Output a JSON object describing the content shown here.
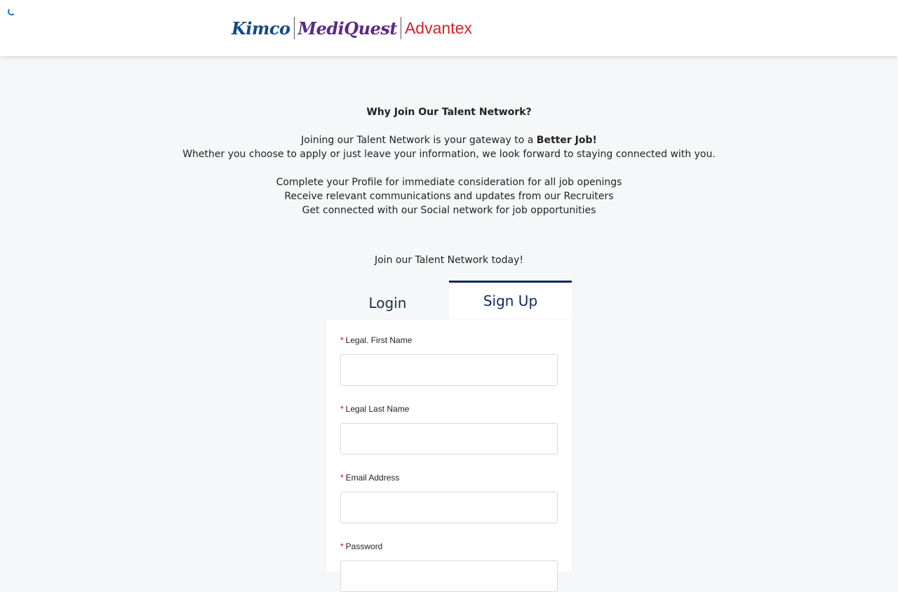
{
  "header": {
    "logo": {
      "part1": "Kimco",
      "part2": "MediQuest",
      "part3": "Advantex"
    }
  },
  "intro": {
    "title": "Why Join Our Talent Network?",
    "line1_prefix": "Joining our Talent Network is your gateway to a ",
    "line1_bold": "Better Job!",
    "line2": "Whether you choose to apply or just leave your information, we look forward to staying connected with you.",
    "benefits": [
      "Complete your Profile for immediate consideration for all job openings",
      "Receive relevant communications and updates from our Recruiters",
      "Get connected with our Social network for job opportunities"
    ],
    "cta": "Join our Talent Network today!"
  },
  "tabs": {
    "login": "Login",
    "signup": "Sign Up"
  },
  "form": {
    "required_mark": "*",
    "fields": [
      {
        "label": "Legal. First Name",
        "value": "",
        "placeholder": ""
      },
      {
        "label": "Legal Last Name",
        "value": "",
        "placeholder": ""
      },
      {
        "label": "Email Address",
        "value": "",
        "placeholder": ""
      },
      {
        "label": "Password",
        "value": "",
        "placeholder": ""
      }
    ]
  },
  "colors": {
    "header_bg": "#ffffff",
    "page_bg": "#f6f7f9",
    "accent": "#0e2a5c",
    "required": "#d0021b",
    "kimco": "#124a86",
    "mediquest": "#5a2a86",
    "advantex": "#d2232a"
  }
}
